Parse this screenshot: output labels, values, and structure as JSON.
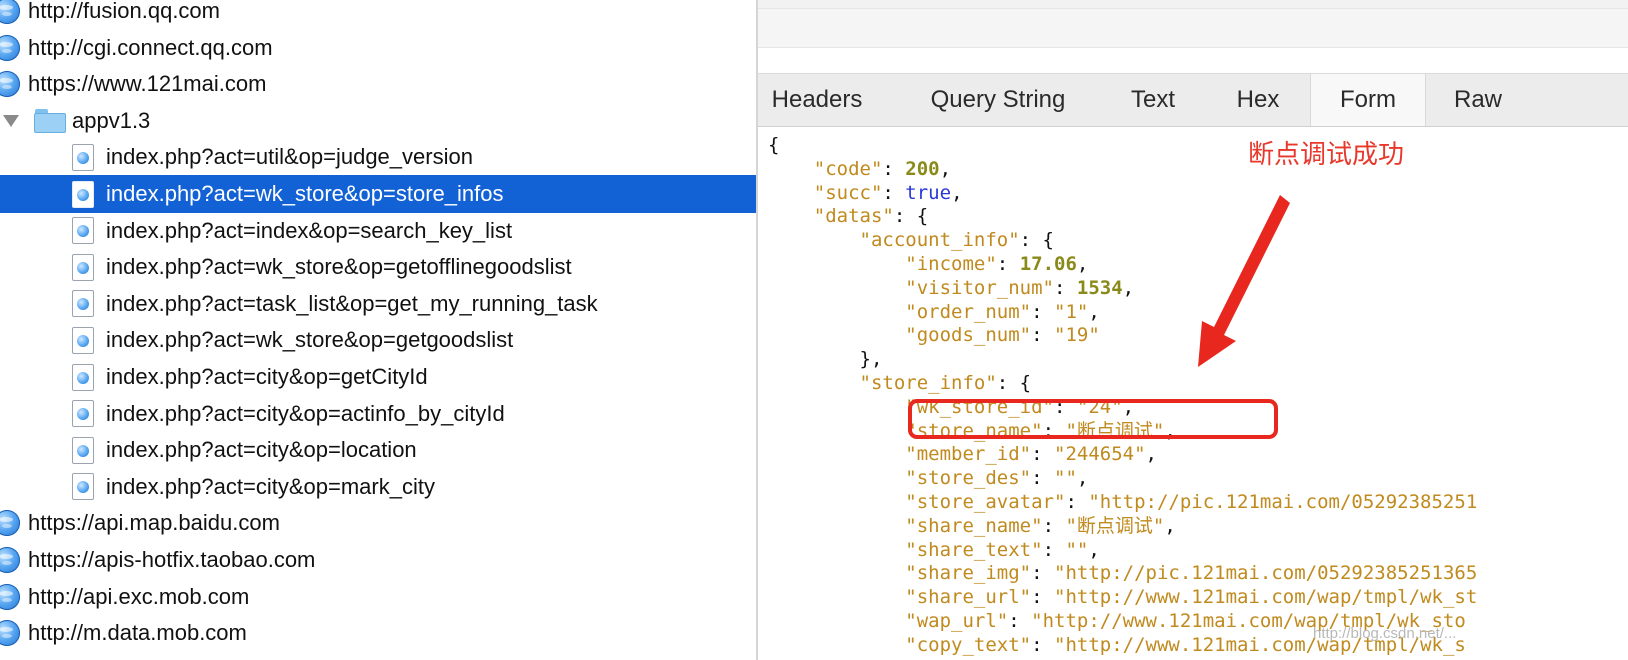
{
  "tree": {
    "rows": [
      {
        "label": "http://fusion.qq.com",
        "kind": "host"
      },
      {
        "label": "http://cgi.connect.qq.com",
        "kind": "host"
      },
      {
        "label": "https://www.121mai.com",
        "kind": "host"
      },
      {
        "label": "appv1.3",
        "kind": "folder"
      },
      {
        "label": "index.php?act=util&op=judge_version",
        "kind": "file"
      },
      {
        "label": "index.php?act=wk_store&op=store_infos",
        "kind": "file",
        "selected": true
      },
      {
        "label": "index.php?act=index&op=search_key_list",
        "kind": "file"
      },
      {
        "label": "index.php?act=wk_store&op=getofflinegoodslist",
        "kind": "file"
      },
      {
        "label": "index.php?act=task_list&op=get_my_running_task",
        "kind": "file"
      },
      {
        "label": "index.php?act=wk_store&op=getgoodslist",
        "kind": "file"
      },
      {
        "label": "index.php?act=city&op=getCityId",
        "kind": "file"
      },
      {
        "label": "index.php?act=city&op=actinfo_by_cityId",
        "kind": "file"
      },
      {
        "label": "index.php?act=city&op=location",
        "kind": "file"
      },
      {
        "label": "index.php?act=city&op=mark_city",
        "kind": "file"
      },
      {
        "label": "https://api.map.baidu.com",
        "kind": "host"
      },
      {
        "label": "https://apis-hotfix.taobao.com",
        "kind": "host"
      },
      {
        "label": "http://api.exc.mob.com",
        "kind": "host"
      },
      {
        "label": "http://m.data.mob.com",
        "kind": "host"
      }
    ]
  },
  "tabs": [
    {
      "label": "Headers"
    },
    {
      "label": "Query String"
    },
    {
      "label": "Text"
    },
    {
      "label": "Hex"
    },
    {
      "label": "Form",
      "active": true
    },
    {
      "label": "Raw"
    }
  ],
  "annotation": {
    "note": "断点调试成功",
    "color": "#e8382c"
  },
  "json_view": {
    "open_brace": "{",
    "code_key": "\"code\"",
    "code_val": "200",
    "succ_key": "\"succ\"",
    "succ_val": "true",
    "datas_key": "\"datas\"",
    "account_info_key": "\"account_info\"",
    "income_key": "\"income\"",
    "income_val": "17.06",
    "visitor_num_key": "\"visitor_num\"",
    "visitor_num_val": "1534",
    "order_num_key": "\"order_num\"",
    "order_num_val": "\"1\"",
    "goods_num_key": "\"goods_num\"",
    "goods_num_val": "\"19\"",
    "close_obj": "},",
    "store_info_key": "\"store_info\"",
    "wk_store_id_key": "\"wk_store_id\"",
    "wk_store_id_val": "\"24\"",
    "store_name_key": "\"store_name\"",
    "store_name_val": "\"断点调试\"",
    "member_id_key": "\"member_id\"",
    "member_id_val": "\"244654\"",
    "store_des_key": "\"store_des\"",
    "store_des_val": "\"\"",
    "store_avatar_key": "\"store_avatar\"",
    "store_avatar_val": "\"http://pic.121mai.com/05292385251",
    "share_name_key": "\"share_name\"",
    "share_name_val": "\"断点调试\"",
    "share_text_key": "\"share_text\"",
    "share_text_val": "\"\"",
    "share_img_key": "\"share_img\"",
    "share_img_val": "\"http://pic.121mai.com/05292385251365",
    "share_url_key": "\"share_url\"",
    "share_url_val": "\"http://www.121mai.com/wap/tmpl/wk_st",
    "wap_url_key": "\"wap_url\"",
    "wap_url_val": "\"http://www.121mai.com/wap/tmpl/wk_sto",
    "copy_text_key": "\"copy_text\"",
    "copy_text_val": "\"http://www.121mai.com/wap/tmpl/wk_s"
  },
  "watermark": "http://blog.csdn.net/..."
}
